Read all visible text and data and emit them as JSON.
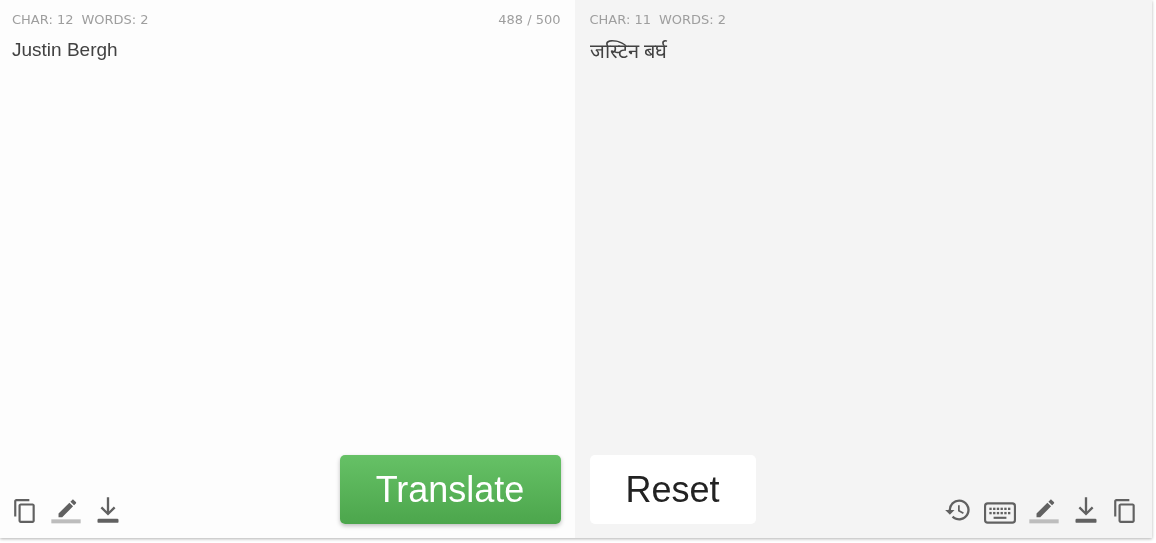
{
  "source": {
    "char_count": "CHAR: 12",
    "word_count": "WORDS: 2",
    "limit": "488 / 500",
    "value": "Justin Bergh",
    "button": "Translate"
  },
  "target": {
    "char_count": "CHAR: 11",
    "word_count": "WORDS: 2",
    "text": "जस्टिन बर्घ",
    "button": "Reset"
  }
}
